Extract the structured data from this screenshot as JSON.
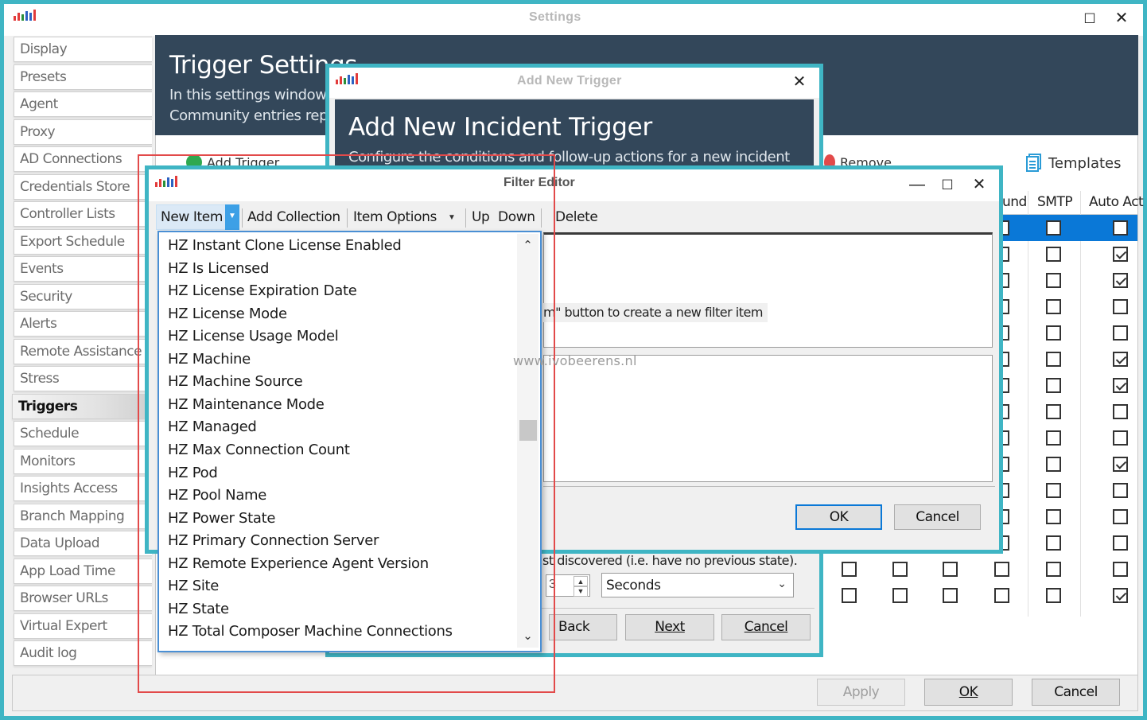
{
  "settings_window": {
    "title": "Settings",
    "sidebar": [
      "Display",
      "Presets",
      "Agent",
      "Proxy",
      "AD Connections",
      "Credentials Store",
      "Controller Lists",
      "Export Schedule",
      "Events",
      "Security",
      "Alerts",
      "Remote Assistance",
      "Stress",
      "Triggers",
      "Schedule",
      "Monitors",
      "Insights Access",
      "Branch Mapping",
      "Data Upload",
      "App Load Time",
      "Browser URLs",
      "Virtual Expert",
      "Audit log"
    ],
    "active_item": "Triggers",
    "header": {
      "title": "Trigger Settings",
      "desc_line1": "In this settings window",
      "desc_line2": "Community entries rep"
    },
    "toolbar": {
      "add_trigger": "Add Trigger",
      "remove": "Remove",
      "templates": "Templates"
    },
    "grid": {
      "columns": [
        "und",
        "SMTP",
        "Auto Act"
      ],
      "auto_act_checked": [
        false,
        true,
        true,
        false,
        false,
        true,
        true,
        false,
        false,
        true,
        false,
        false,
        false,
        false,
        true
      ]
    },
    "buttons": {
      "apply": "Apply",
      "ok": "OK",
      "cancel": "Cancel"
    }
  },
  "add_trigger_window": {
    "title": "Add New Trigger",
    "heading": "Add New Incident Trigger",
    "description": "Configure the conditions and follow-up actions for a new incident",
    "discovered_text": "st discovered (i.e. have no previous state).",
    "interval_value": "3",
    "unit_selected": "Seconds",
    "buttons": {
      "back": "Back",
      "next": "Next",
      "cancel": "Cancel"
    }
  },
  "filter_editor": {
    "title": "Filter Editor",
    "menu": {
      "new_item": "New Item",
      "add_collection": "Add Collection",
      "item_options": "Item Options",
      "up": "Up",
      "down": "Down",
      "delete": "Delete"
    },
    "hint": "m\" button to create a new filter item",
    "buttons": {
      "ok": "OK",
      "cancel": "Cancel"
    },
    "dropdown_items": [
      "HZ Instant Clone License Enabled",
      "HZ Is Licensed",
      "HZ License Expiration Date",
      "HZ License Mode",
      "HZ License Usage Model",
      "HZ Machine",
      "HZ Machine Source",
      "HZ Maintenance Mode",
      "HZ Managed",
      "HZ Max Connection Count",
      "HZ Pod",
      "HZ Pool Name",
      "HZ Power State",
      "HZ Primary Connection Server",
      "HZ Remote Experience Agent Version",
      "HZ Site",
      "HZ State",
      "HZ Total Composer Machine Connections"
    ]
  },
  "watermark": "www.ivobeerens.nl",
  "colors": {
    "accent_border": "#3fb5c4",
    "header_bg": "#33475a",
    "selection_blue": "#0a78d7",
    "highlight_red": "#e24a4a"
  }
}
